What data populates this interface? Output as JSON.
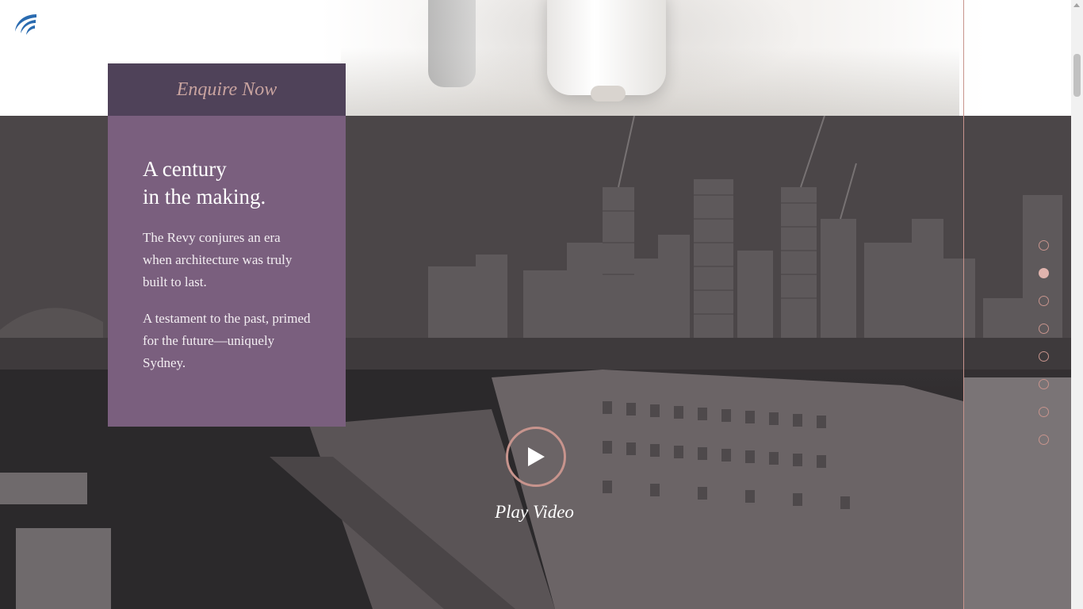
{
  "logo": {
    "icon": "brand-swoosh-icon",
    "color": "#2a6bb0"
  },
  "enquire": {
    "label": "Enquire Now"
  },
  "card": {
    "heading_line1": "A century",
    "heading_line2": "in the making.",
    "paragraph1": "The Revy conjures an era when architecture was truly built to last.",
    "paragraph2": "A testament to the past, primed for the future—uniquely Sydney."
  },
  "video": {
    "label": "Play Video",
    "icon": "play-icon"
  },
  "section_nav": {
    "count": 8,
    "active_index": 1
  },
  "colors": {
    "accent": "#c7948d",
    "enquire_bg": "#4f4259",
    "card_bg": "#7a5f7e",
    "enquire_text": "#c9a4a0"
  }
}
